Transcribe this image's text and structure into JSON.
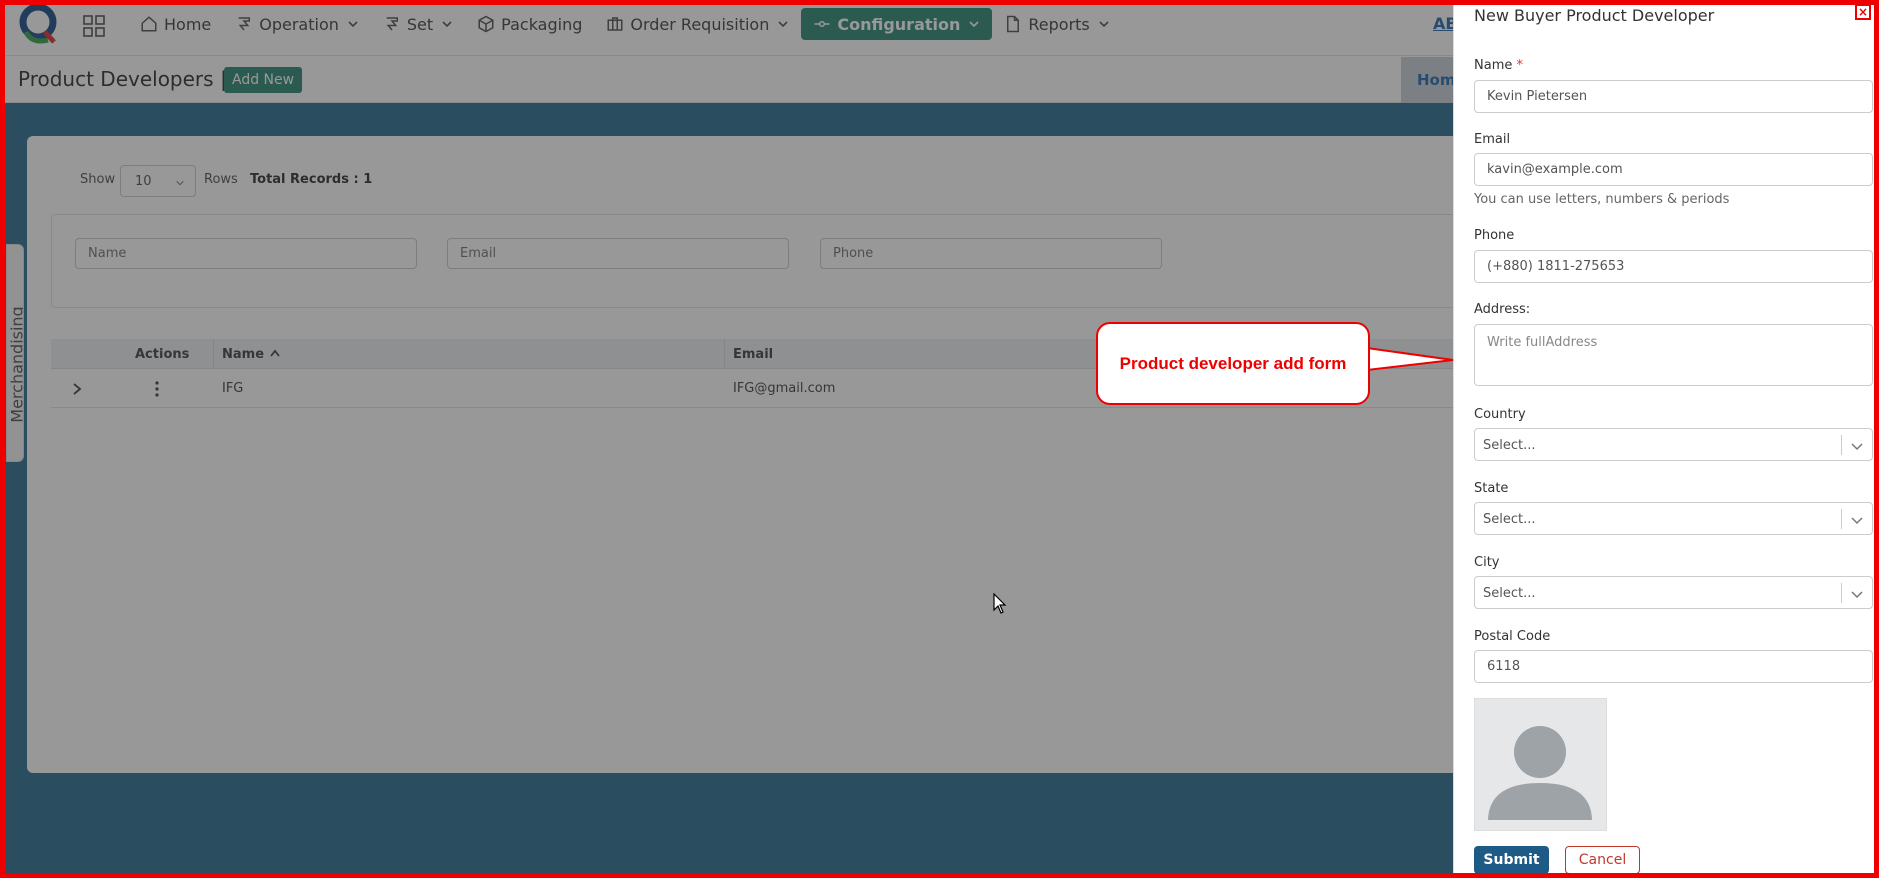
{
  "nav": {
    "items": [
      {
        "label": "Home",
        "icon": "home-icon"
      },
      {
        "label": "Operation",
        "icon": "stamp-icon"
      },
      {
        "label": "Set",
        "icon": "stamp-icon"
      },
      {
        "label": "Packaging",
        "icon": "box-icon"
      },
      {
        "label": "Order Requisition",
        "icon": "briefcase-icon"
      },
      {
        "label": "Configuration",
        "icon": "commit-icon",
        "active": true
      },
      {
        "label": "Reports",
        "icon": "file-icon"
      }
    ],
    "user_abbr": "AB",
    "active_color": "#2f8a76"
  },
  "header": {
    "title": "Product Developers",
    "separator": "|",
    "add_new": "Add New",
    "breadcrumb_home": "Hom"
  },
  "side_tab": {
    "label": "Merchandising"
  },
  "list": {
    "show_label": "Show",
    "rows_value": "10",
    "rows_label": "Rows",
    "total_records": "Total Records : 1",
    "filters": {
      "name": "Name",
      "email": "Email",
      "phone": "Phone"
    },
    "columns": [
      "Actions",
      "Name",
      "Email"
    ],
    "rows": [
      {
        "name": "IFG",
        "email": "IFG@gmail.com"
      }
    ]
  },
  "drawer": {
    "title": "New Buyer Product Developer",
    "close": "×",
    "name_label": "Name",
    "name_required": "*",
    "name_value": "Kevin Pietersen",
    "email_label": "Email",
    "email_value": "kavin@example.com",
    "email_help": "You can use letters, numbers & periods",
    "phone_label": "Phone",
    "phone_value": "(+880) 1811-275653",
    "address_label": "Address:",
    "address_placeholder": "Write fullAddress",
    "country_label": "Country",
    "country_value": "Select...",
    "state_label": "State",
    "state_value": "Select...",
    "city_label": "City",
    "city_value": "Select...",
    "postal_label": "Postal Code",
    "postal_value": "6118",
    "submit": "Submit",
    "cancel": "Cancel"
  },
  "annotation": {
    "callout": "Product developer add form",
    "color": "#e00000"
  }
}
